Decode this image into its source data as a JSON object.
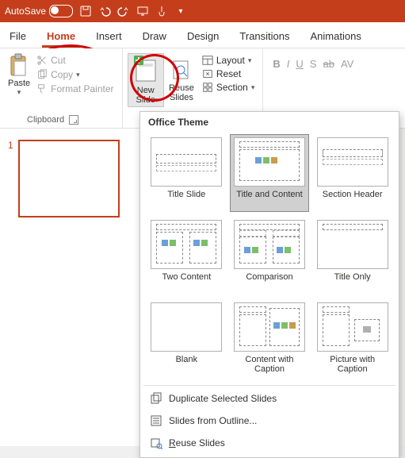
{
  "titlebar": {
    "autosave_label": "AutoSave"
  },
  "tabs": {
    "file": "File",
    "home": "Home",
    "insert": "Insert",
    "draw": "Draw",
    "design": "Design",
    "transitions": "Transitions",
    "animations": "Animations"
  },
  "ribbon": {
    "paste": "Paste",
    "cut": "Cut",
    "copy": "Copy",
    "format_painter": "Format Painter",
    "clipboard_label": "Clipboard",
    "new_slide": "New\nSlide",
    "reuse_slides": "Reuse\nSlides",
    "layout": "Layout",
    "reset": "Reset",
    "section": "Section",
    "font_b": "B",
    "font_i": "I",
    "font_u": "U",
    "font_s": "S",
    "font_ab": "ab",
    "font_av": "AV"
  },
  "thumbs": {
    "num1": "1"
  },
  "dropdown": {
    "header": "Office Theme",
    "layouts": {
      "title_slide": "Title Slide",
      "title_content": "Title and Content",
      "section_header": "Section Header",
      "two_content": "Two Content",
      "comparison": "Comparison",
      "title_only": "Title Only",
      "blank": "Blank",
      "content_caption": "Content with Caption",
      "picture_caption": "Picture with Caption"
    },
    "duplicate": "Duplicate Selected Slides",
    "from_outline": "Slides from Outline...",
    "reuse": "Reuse Slides"
  }
}
